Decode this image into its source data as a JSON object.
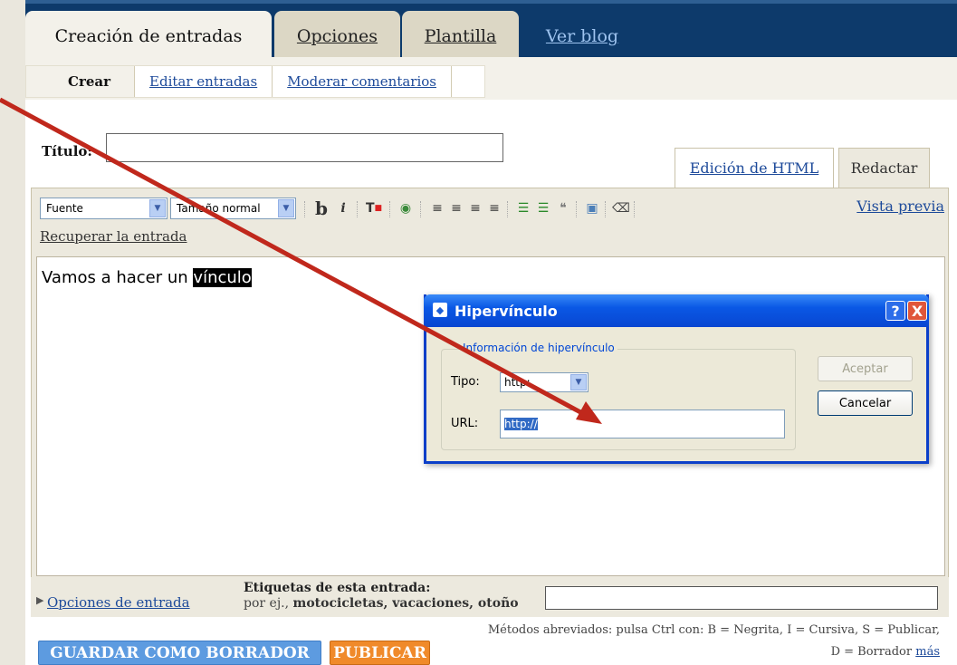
{
  "tabs": {
    "create_posts": "Creación de entradas",
    "options": "Opciones",
    "template": "Plantilla",
    "view_blog": "Ver blog"
  },
  "subtabs": {
    "create": "Crear",
    "edit_posts": "Editar entradas",
    "moderate_comments": "Moderar comentarios"
  },
  "post": {
    "title_label": "Título:",
    "title_value": "",
    "body_text": "Vamos a hacer un ",
    "body_selected": "vínculo"
  },
  "editor_tabs": {
    "html": "Edición de HTML",
    "compose": "Redactar"
  },
  "toolbar": {
    "font_select": "Fuente",
    "size_select": "Tamaño normal",
    "bold": "b",
    "italic": "i",
    "preview": "Vista previa",
    "recover": "Recuperar la entrada"
  },
  "bottom": {
    "post_options": "Opciones de entrada",
    "labels_title": "Etiquetas de esta entrada:",
    "labels_hint_prefix": "por ej.,",
    "labels_hint_examples": "motocicletas, vacaciones, otoño",
    "labels_value": "",
    "save_draft": "GUARDAR COMO BORRADOR",
    "publish": "PUBLICAR",
    "shortcuts_line1": "Métodos abreviados: pulsa Ctrl con: B = Negrita, I = Cursiva, S = Publicar,",
    "shortcuts_line2": "D = Borrador",
    "shortcuts_more": "más"
  },
  "dialog": {
    "title": "Hipervínculo",
    "help": "?",
    "close": "X",
    "legend": "Información de hipervínculo",
    "type_label": "Tipo:",
    "type_value": "http:",
    "url_label": "URL:",
    "url_value": "http://",
    "ok": "Aceptar",
    "cancel": "Cancelar"
  },
  "colors": {
    "topbar": "#0d3a6b",
    "link": "#1d4a9a",
    "draft_button": "#5d9be0",
    "publish_button": "#f08a2a",
    "annotation_arrow": "#c0281c",
    "dialog_title": "#0a58e5"
  }
}
